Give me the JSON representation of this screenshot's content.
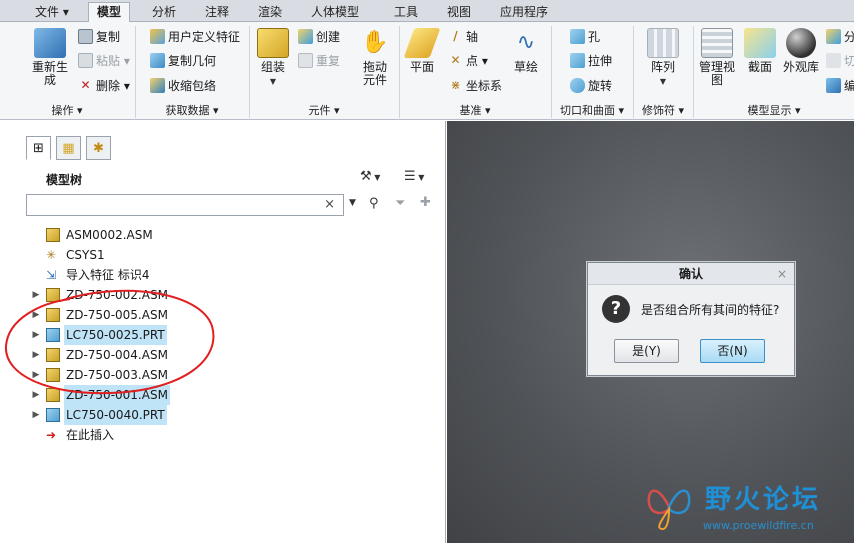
{
  "tabs": [
    {
      "label": "文件 ▾"
    },
    {
      "label": "模型"
    },
    {
      "label": "分析"
    },
    {
      "label": "注释"
    },
    {
      "label": "渲染"
    },
    {
      "label": "人体模型"
    },
    {
      "label": "工具"
    },
    {
      "label": "视图"
    },
    {
      "label": "应用程序"
    }
  ],
  "ribbon": {
    "groups": {
      "operation": "操作 ▾",
      "get_data": "获取数据 ▾",
      "component": "元件 ▾",
      "datum": "基准 ▾",
      "cut_surface": "切口和曲面 ▾",
      "modifier": "修饰符 ▾",
      "model_display": "模型显示 ▾"
    },
    "regenerate": "重新生成",
    "copy": "复制",
    "paste": "粘贴 ▾",
    "delete": "删除 ▾",
    "user_defined_feature": "用户定义特征",
    "copy_geometry": "复制几何",
    "shrinkwrap": "收缩包络",
    "assemble": "组装",
    "create": "创建",
    "repeat": "重复",
    "drag_component": "拖动元件",
    "plane": "平面",
    "axis": "轴",
    "point": "点 ▾",
    "coord_sys": "坐标系",
    "sketch": "草绘",
    "hole": "孔",
    "extrude": "拉伸",
    "revolve": "旋转",
    "pattern": "阵列",
    "manage_view": "管理视图",
    "section": "截面",
    "appearance_lib": "外观库",
    "partial_1": "分",
    "partial_2": "切",
    "partial_3": "编"
  },
  "tree": {
    "title": "模型树",
    "search_placeholder": "",
    "search_clear": "×",
    "rows": [
      {
        "label": "ASM0002.ASM",
        "type": "asm",
        "expand": "",
        "selected": false
      },
      {
        "label": "CSYS1",
        "type": "csys",
        "expand": "",
        "selected": false
      },
      {
        "label": "导入特征 标识4",
        "type": "import",
        "expand": "",
        "selected": false
      },
      {
        "label": "ZD-750-002.ASM",
        "type": "asm",
        "expand": "▶",
        "selected": false
      },
      {
        "label": "ZD-750-005.ASM",
        "type": "asm",
        "expand": "▶",
        "selected": false
      },
      {
        "label": "LC750-0025.PRT",
        "type": "prt",
        "expand": "▶",
        "selected": true
      },
      {
        "label": "ZD-750-004.ASM",
        "type": "asm",
        "expand": "▶",
        "selected": false
      },
      {
        "label": "ZD-750-003.ASM",
        "type": "asm",
        "expand": "▶",
        "selected": false
      },
      {
        "label": "ZD-750-001.ASM",
        "type": "asm",
        "expand": "▶",
        "selected": true
      },
      {
        "label": "LC750-0040.PRT",
        "type": "prt",
        "expand": "▶",
        "selected": true
      },
      {
        "label": "在此插入",
        "type": "insert",
        "expand": "",
        "selected": false
      }
    ]
  },
  "dialog": {
    "title": "确认",
    "close": "×",
    "question_mark": "?",
    "message": "是否组合所有其间的特征?",
    "yes": "是(Y)",
    "no": "否(N)"
  },
  "watermark": {
    "text": "野火论坛",
    "url": "www.proewildfire.cn"
  },
  "colors": {
    "selection": "#bfe3f7",
    "annotation_circle": "#e02020",
    "brand_blue": "#1f8fd6"
  }
}
